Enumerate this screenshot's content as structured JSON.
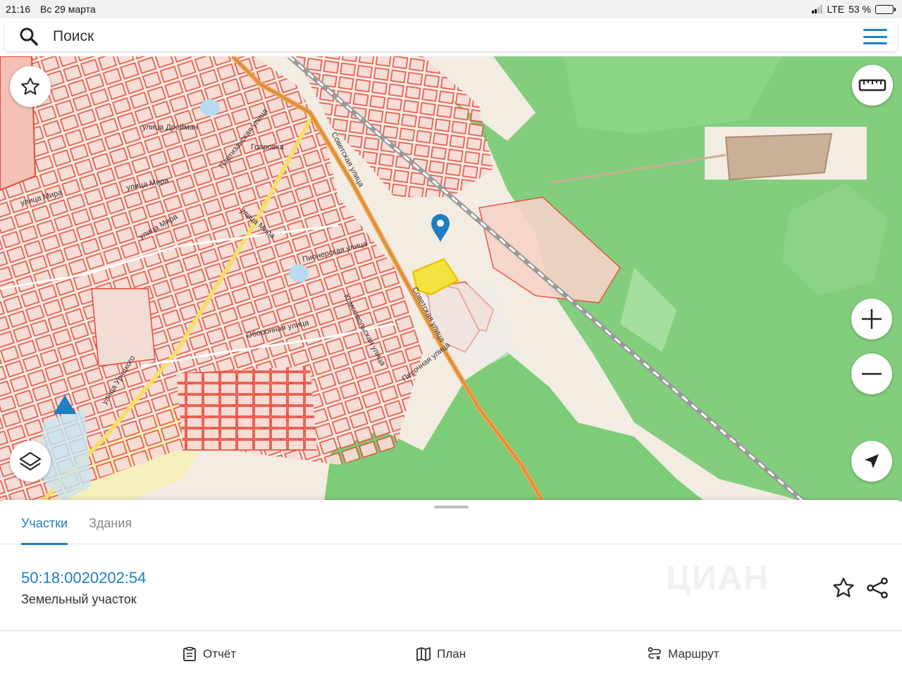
{
  "status_bar": {
    "time": "21:16",
    "date": "Вс 29 марта",
    "network": "LTE",
    "battery": "53 %",
    "battery_level": 0.53
  },
  "search": {
    "placeholder": "Поиск"
  },
  "map": {
    "streets": [
      "улица Дрейман",
      "Партизанская улица",
      "улица Мира",
      "улица Мира",
      "улица Мира",
      "улица Мира",
      "улица Урицкого",
      "Советская улица",
      "Советская улица",
      "Оборонная улица",
      "Комсомольская улица",
      "Песочная улица",
      "Пионерская улица",
      "Гоаровка"
    ]
  },
  "tabs": [
    {
      "label": "Участки",
      "active": true
    },
    {
      "label": "Здания",
      "active": false
    }
  ],
  "parcel": {
    "cadastral_number": "50:18:0020202:54",
    "type": "Земельный участок",
    "watermark": "ЦИАН"
  },
  "bottom_bar": {
    "report_label": "Отчёт",
    "plan_label": "План",
    "route_label": "Маршрут"
  },
  "colors": {
    "accent": "#1d7fc4",
    "parcel_stroke": "#e8483b",
    "forest": "#5cc05a",
    "selected_parcel": "#f2e340"
  }
}
